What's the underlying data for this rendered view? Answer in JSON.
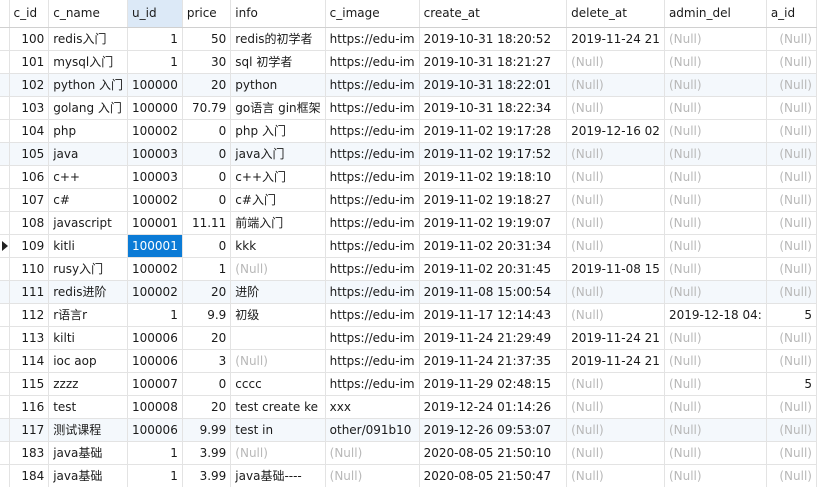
{
  "columns": [
    "c_id",
    "c_name",
    "u_id",
    "price",
    "info",
    "c_image",
    "create_at",
    "delete_at",
    "admin_del",
    "a_id"
  ],
  "null_text": "(Null)",
  "rows": [
    {
      "c_id": "100",
      "c_name": "redis入门",
      "u_id": "1",
      "price": "50",
      "info": "redis的初学者",
      "c_image": "https://edu-im",
      "create_at": "2019-10-31 18:20:52",
      "delete_at": "2019-11-24 21",
      "admin_del": null,
      "a_id": null
    },
    {
      "c_id": "101",
      "c_name": "mysql入门",
      "u_id": "1",
      "price": "30",
      "info": "sql 初学者",
      "c_image": "https://edu-im",
      "create_at": "2019-10-31 18:21:27",
      "delete_at": null,
      "admin_del": null,
      "a_id": null
    },
    {
      "c_id": "102",
      "c_name": "python 入门",
      "u_id": "100000",
      "price": "20",
      "info": "python",
      "c_image": "https://edu-im",
      "create_at": "2019-10-31 18:22:01",
      "delete_at": null,
      "admin_del": null,
      "a_id": null
    },
    {
      "c_id": "103",
      "c_name": "golang 入门",
      "u_id": "100000",
      "price": "70.79",
      "info": "go语言 gin框架",
      "c_image": "https://edu-im",
      "create_at": "2019-10-31 18:22:34",
      "delete_at": null,
      "admin_del": null,
      "a_id": null
    },
    {
      "c_id": "104",
      "c_name": "php",
      "u_id": "100002",
      "price": "0",
      "info": "php 入门",
      "c_image": "https://edu-im",
      "create_at": "2019-11-02 19:17:28",
      "delete_at": "2019-12-16 02",
      "admin_del": null,
      "a_id": null
    },
    {
      "c_id": "105",
      "c_name": "java",
      "u_id": "100003",
      "price": "0",
      "info": "java入门",
      "c_image": "https://edu-im",
      "create_at": "2019-11-02 19:17:52",
      "delete_at": null,
      "admin_del": null,
      "a_id": null
    },
    {
      "c_id": "106",
      "c_name": "c++",
      "u_id": "100003",
      "price": "0",
      "info": "c++入门",
      "c_image": "https://edu-im",
      "create_at": "2019-11-02 19:18:10",
      "delete_at": null,
      "admin_del": null,
      "a_id": null
    },
    {
      "c_id": "107",
      "c_name": "c#",
      "u_id": "100002",
      "price": "0",
      "info": "c#入门",
      "c_image": "https://edu-im",
      "create_at": "2019-11-02 19:18:27",
      "delete_at": null,
      "admin_del": null,
      "a_id": null
    },
    {
      "c_id": "108",
      "c_name": "javascript",
      "u_id": "100001",
      "price": "11.11",
      "info": "前端入门",
      "c_image": "https://edu-im",
      "create_at": "2019-11-02 19:19:07",
      "delete_at": null,
      "admin_del": null,
      "a_id": null
    },
    {
      "c_id": "109",
      "c_name": "kitli",
      "u_id": "100001",
      "price": "0",
      "info": "kkk",
      "c_image": "https://edu-im",
      "create_at": "2019-11-02 20:31:34",
      "delete_at": null,
      "admin_del": null,
      "a_id": null
    },
    {
      "c_id": "110",
      "c_name": "rusy入门",
      "u_id": "100002",
      "price": "1",
      "info": null,
      "c_image": "https://edu-im",
      "create_at": "2019-11-02 20:31:45",
      "delete_at": "2019-11-08 15",
      "admin_del": null,
      "a_id": null
    },
    {
      "c_id": "111",
      "c_name": "redis进阶",
      "u_id": "100002",
      "price": "20",
      "info": "进阶",
      "c_image": "https://edu-im",
      "create_at": "2019-11-08 15:00:54",
      "delete_at": null,
      "admin_del": null,
      "a_id": null
    },
    {
      "c_id": "112",
      "c_name": "r语言r",
      "u_id": "1",
      "price": "9.9",
      "info": "初级",
      "c_image": "https://edu-im",
      "create_at": "2019-11-17 12:14:43",
      "delete_at": null,
      "admin_del": "2019-12-18 04:",
      "a_id": "5"
    },
    {
      "c_id": "113",
      "c_name": "kilti",
      "u_id": "100006",
      "price": "20",
      "info": "",
      "c_image": "https://edu-im",
      "create_at": "2019-11-24 21:29:49",
      "delete_at": "2019-11-24 21",
      "admin_del": null,
      "a_id": null
    },
    {
      "c_id": "114",
      "c_name": "ioc aop",
      "u_id": "100006",
      "price": "3",
      "info": null,
      "c_image": "https://edu-im",
      "create_at": "2019-11-24 21:37:35",
      "delete_at": "2019-11-24 21",
      "admin_del": null,
      "a_id": null
    },
    {
      "c_id": "115",
      "c_name": "zzzz",
      "u_id": "100007",
      "price": "0",
      "info": "cccc",
      "c_image": "https://edu-im",
      "create_at": "2019-11-29 02:48:15",
      "delete_at": null,
      "admin_del": null,
      "a_id": "5"
    },
    {
      "c_id": "116",
      "c_name": "test",
      "u_id": "100008",
      "price": "20",
      "info": "test create ke",
      "c_image": "xxx",
      "create_at": "2019-12-24 01:14:26",
      "delete_at": null,
      "admin_del": null,
      "a_id": null
    },
    {
      "c_id": "117",
      "c_name": "测试课程",
      "u_id": "100006",
      "price": "9.99",
      "info": "test in",
      "c_image": "other/091b10",
      "create_at": "2019-12-26 09:53:07",
      "delete_at": null,
      "admin_del": null,
      "a_id": null
    },
    {
      "c_id": "183",
      "c_name": "java基础",
      "u_id": "1",
      "price": "3.99",
      "info": null,
      "c_image": null,
      "create_at": "2020-08-05 21:50:10",
      "delete_at": null,
      "admin_del": null,
      "a_id": null
    },
    {
      "c_id": "184",
      "c_name": "java基础",
      "u_id": "1",
      "price": "3.99",
      "info": "java基础----",
      "c_image": null,
      "create_at": "2020-08-05 21:50:47",
      "delete_at": null,
      "admin_del": null,
      "a_id": null
    }
  ],
  "selected": {
    "row": 9,
    "column": "u_id"
  },
  "current_row": 9,
  "highlight_rows": [
    2,
    5,
    11,
    17
  ],
  "colors": {
    "selection": "#0b7bd6",
    "null_text": "#b8b8b8",
    "alt_row": "#f4f8fc",
    "selected_header": "#dce9f7"
  }
}
